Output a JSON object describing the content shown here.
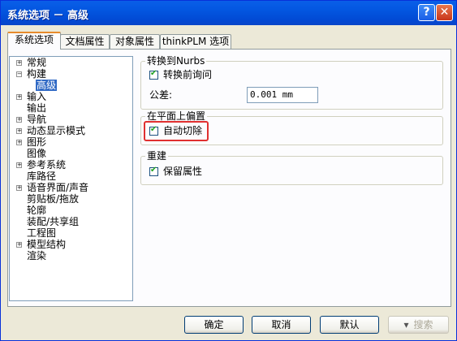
{
  "window": {
    "title": "系统选项 － 高级",
    "help_glyph": "?",
    "close_glyph": "✕"
  },
  "tabs": [
    {
      "label": "系统选项",
      "active": true
    },
    {
      "label": "文档属性",
      "active": false
    },
    {
      "label": "对象属性",
      "active": false
    },
    {
      "label": "thinkPLM 选项",
      "active": false
    }
  ],
  "tree": [
    {
      "label": "常规",
      "expander": "+"
    },
    {
      "label": "构建",
      "expander": "−"
    },
    {
      "label": "高级",
      "expander": "",
      "selected": true
    },
    {
      "label": "输入",
      "expander": "+"
    },
    {
      "label": "输出",
      "expander": ""
    },
    {
      "label": "导航",
      "expander": "+"
    },
    {
      "label": "动态显示模式",
      "expander": "+"
    },
    {
      "label": "图形",
      "expander": "+"
    },
    {
      "label": "图像",
      "expander": ""
    },
    {
      "label": "参考系统",
      "expander": "+"
    },
    {
      "label": "库路径",
      "expander": ""
    },
    {
      "label": "语音界面/声音",
      "expander": "+"
    },
    {
      "label": "剪贴板/拖放",
      "expander": ""
    },
    {
      "label": "轮廓",
      "expander": ""
    },
    {
      "label": "装配/共享组",
      "expander": ""
    },
    {
      "label": "工程图",
      "expander": ""
    },
    {
      "label": "模型结构",
      "expander": "+"
    },
    {
      "label": "渲染",
      "expander": ""
    }
  ],
  "groups": {
    "nurbs": {
      "title": "转换到Nurbs",
      "checkbox_label": "转换前询问",
      "checked": true,
      "tolerance_label": "公差:",
      "tolerance_value": "0.001 mm"
    },
    "offset": {
      "title": "在平面上偏置",
      "checkbox_label": "自动切除",
      "checked": true
    },
    "rebuild": {
      "title": "重建",
      "checkbox_label": "保留属性",
      "checked": true
    }
  },
  "buttons": {
    "ok": "确定",
    "cancel": "取消",
    "default": "默认",
    "search": "搜索",
    "search_glyph": "▾"
  }
}
